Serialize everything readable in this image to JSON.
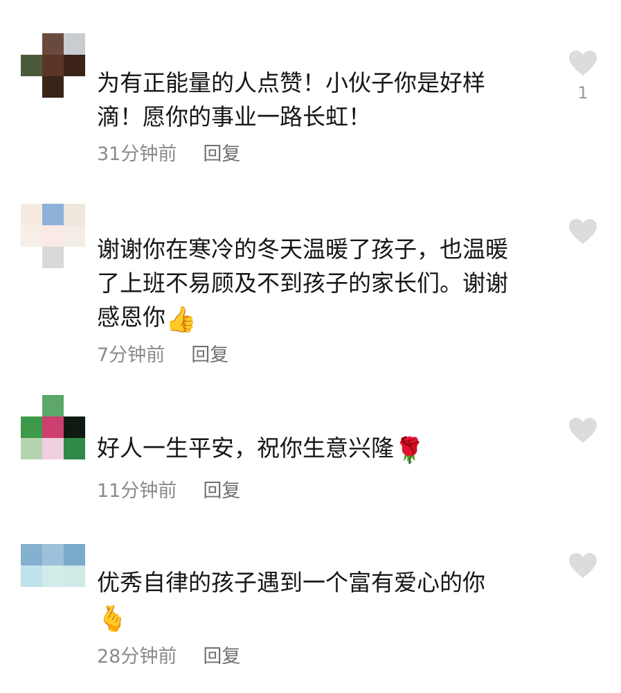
{
  "comments": [
    {
      "text": "为有正能量的人点赞！小伙子你是好样\n滴！愿你的事业一路长虹！",
      "time": "31分钟前",
      "reply": "回复",
      "likes": "1",
      "avatar_colors": [
        "#ffffff",
        "#6b4a3e",
        "#c8cdd2",
        "#4a5a3a",
        "#5b3426",
        "#3b2318",
        "#ffffff",
        "#3a2418",
        "#ffffff"
      ]
    },
    {
      "text": "谢谢你在寒冷的冬天温暖了孩子，也温暖\n了上班不易顾及不到孩子的家长们。谢谢\n感恩你",
      "emoji": "👍",
      "time": "7分钟前",
      "reply": "回复",
      "likes": "",
      "avatar_colors": [
        "#f7ebe1",
        "#8fb0d8",
        "#efe6dc",
        "#f7eee8",
        "#fbe9e5",
        "#f3ede6",
        "#ffffff",
        "#d9d9d9",
        "#ffffff"
      ]
    },
    {
      "text": "好人一生平安，祝你生意兴隆",
      "emoji": "🌹",
      "time": "11分钟前",
      "reply": "回复",
      "likes": "",
      "avatar_colors": [
        "#ffffff",
        "#5ba86a",
        "#ffffff",
        "#3e9a4a",
        "#cc3f6f",
        "#0e1a10",
        "#b5d4ae",
        "#f0cfe0",
        "#2f8a4a"
      ]
    },
    {
      "text": "优秀自律的孩子遇到一个富有爱心的你\n",
      "emoji": "🫰",
      "time": "28分钟前",
      "reply": "回复",
      "likes": "",
      "avatar_colors": [
        "#86b0cf",
        "#9cc1da",
        "#7aa9cc",
        "#bfe2ec",
        "#d0ebe8",
        "#cdeae6",
        "#ffffff",
        "#ffffff",
        "#ffffff"
      ]
    }
  ]
}
